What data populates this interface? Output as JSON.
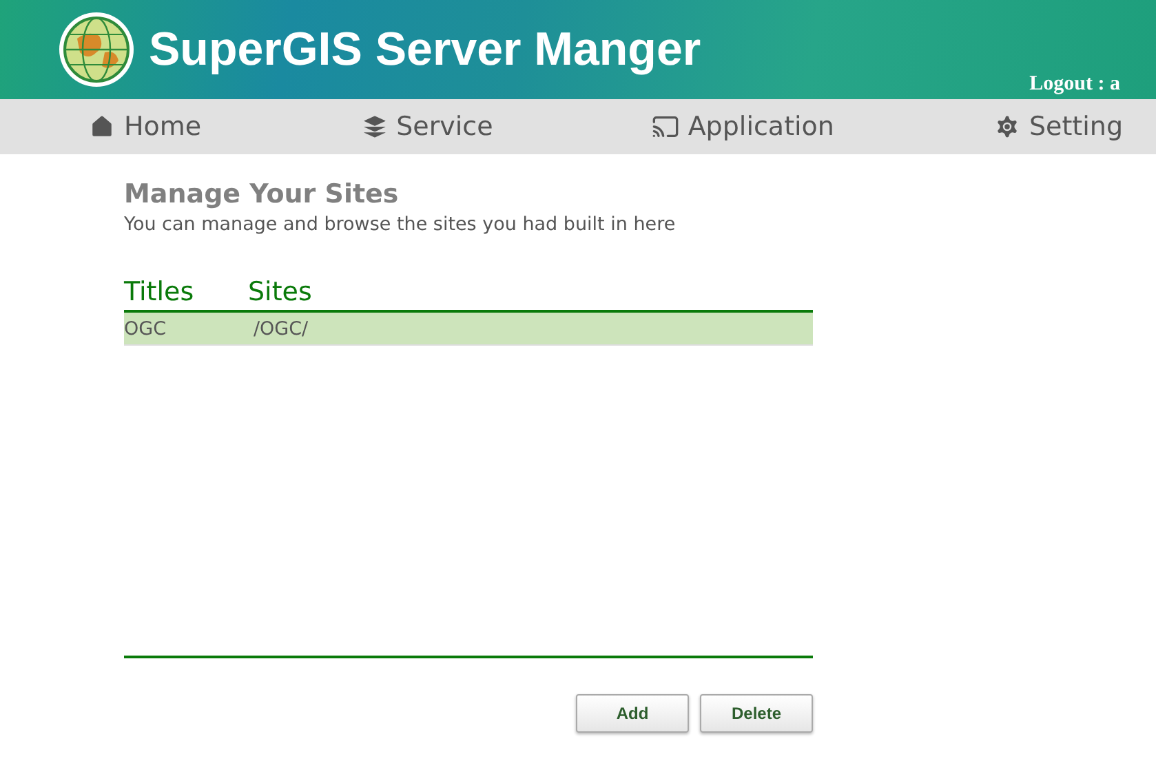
{
  "header": {
    "title": "SuperGIS Server Manger",
    "logout": "Logout : a"
  },
  "nav": [
    {
      "label": "Home"
    },
    {
      "label": "Service"
    },
    {
      "label": "Application"
    },
    {
      "label": "Setting"
    }
  ],
  "page": {
    "title": "Manage Your Sites",
    "subtitle": "You can manage and browse the sites you had built in here"
  },
  "table": {
    "columns": [
      "Titles",
      "Sites"
    ],
    "rows": [
      {
        "cells": [
          "OGC",
          "/OGC/"
        ],
        "selected": true
      }
    ]
  },
  "buttons": [
    "Add",
    "Delete"
  ]
}
